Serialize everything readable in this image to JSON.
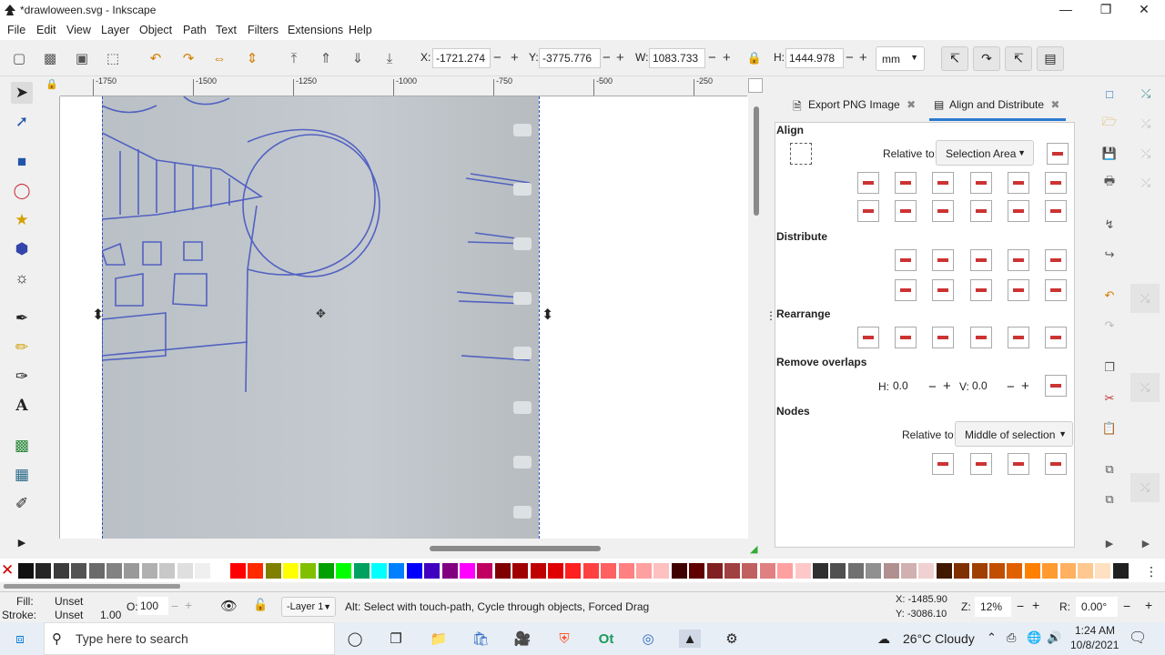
{
  "window": {
    "title": "*drawloween.svg - Inkscape"
  },
  "menu": [
    "File",
    "Edit",
    "View",
    "Layer",
    "Object",
    "Path",
    "Text",
    "Filters",
    "Extensions",
    "Help"
  ],
  "toolbar": {
    "x_label": "X:",
    "x_value": "-1721.274",
    "y_label": "Y:",
    "y_value": "-3775.776",
    "w_label": "W:",
    "w_value": "1083.733",
    "h_label": "H:",
    "h_value": "1444.978",
    "unit": "mm"
  },
  "ruler": {
    "labels": [
      "-1750",
      "-1500",
      "-1250",
      "-1000",
      "-750",
      "-500",
      "-250"
    ]
  },
  "panel": {
    "tabs": [
      {
        "label": "Export PNG Image"
      },
      {
        "label": "Align and Distribute"
      }
    ],
    "align_title": "Align",
    "relative_label": "Relative to:",
    "relative_value": "Selection Area",
    "distribute_title": "Distribute",
    "rearrange_title": "Rearrange",
    "remove_overlaps_title": "Remove overlaps",
    "h_label": "H:",
    "h_value": "0.0",
    "v_label": "V:",
    "v_value": "0.0",
    "nodes_title": "Nodes",
    "nodes_relative_label": "Relative to:",
    "nodes_relative_value": "Middle of selection"
  },
  "status": {
    "fill_label": "Fill:",
    "fill_value": "Unset",
    "stroke_label": "Stroke:",
    "stroke_value": "Unset",
    "stroke_width": "1.00",
    "opacity_label": "O:",
    "opacity_value": "100",
    "layer": "-Layer 1",
    "message": "Alt: Select with touch-path, Cycle through objects, Forced Drag",
    "cursor_x": "X: -1485.90",
    "cursor_y": "Y: -3086.10",
    "zoom_label": "Z:",
    "zoom_value": "12%",
    "rotate_label": "R:",
    "rotate_value": "0.00°"
  },
  "taskbar": {
    "search_placeholder": "Type here to search",
    "weather": "26°C  Cloudy",
    "time": "1:24 AM",
    "date": "10/8/2021"
  },
  "colors": {
    "palette": [
      "#111111",
      "#262626",
      "#3c3c3c",
      "#535353",
      "#6a6a6a",
      "#828282",
      "#999999",
      "#b0b0b0",
      "#c8c8c8",
      "#dfdfdf",
      "#efefef",
      "#ffffff",
      "#ff0000",
      "#ff2a00",
      "#808000",
      "#ffff00",
      "#80c000",
      "#00a000",
      "#00ff00",
      "#00a060",
      "#00ffff",
      "#0080ff",
      "#0000ff",
      "#4000c0",
      "#800080",
      "#ff00ff",
      "#c00060",
      "#800000",
      "#a00000",
      "#c00000",
      "#e00000",
      "#ff2020",
      "#ff4040",
      "#ff6060",
      "#ff8080",
      "#ffa0a0",
      "#ffc0c0",
      "#400000",
      "#600000",
      "#802020",
      "#a04040",
      "#c06060",
      "#e08080",
      "#ffa0a0",
      "#ffc8c8",
      "#303030",
      "#505050",
      "#707070",
      "#909090",
      "#b09090",
      "#d0b0b0",
      "#f0d0d0",
      "#401800",
      "#803000",
      "#a04000",
      "#c05000",
      "#e06000",
      "#ff8000",
      "#ff9a30",
      "#ffb060",
      "#ffc890",
      "#ffe0c0",
      "#202020"
    ]
  }
}
